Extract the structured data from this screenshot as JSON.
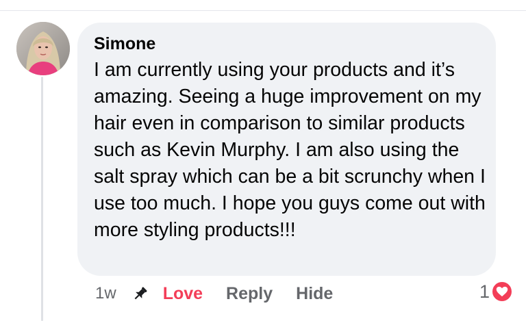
{
  "comment": {
    "author": "Simone",
    "text": "I am currently using your products and it’s amazing. Seeing a huge improvement on my hair even in comparison to similar products such as Kevin Murphy. I am also using the salt spray which can be a bit scrunchy when I use too much. I hope you guys come out with more styling products!!!",
    "timestamp": "1w",
    "actions": {
      "love": "Love",
      "reply": "Reply",
      "hide": "Hide"
    },
    "reactions": {
      "count": "1",
      "icon": "heart-icon"
    }
  },
  "colors": {
    "bubble_background": "#f0f2f5",
    "love_color": "#f33e58",
    "secondary_text": "#65676b"
  },
  "icons": {
    "pin": "pin-icon",
    "reaction": "heart-icon"
  }
}
